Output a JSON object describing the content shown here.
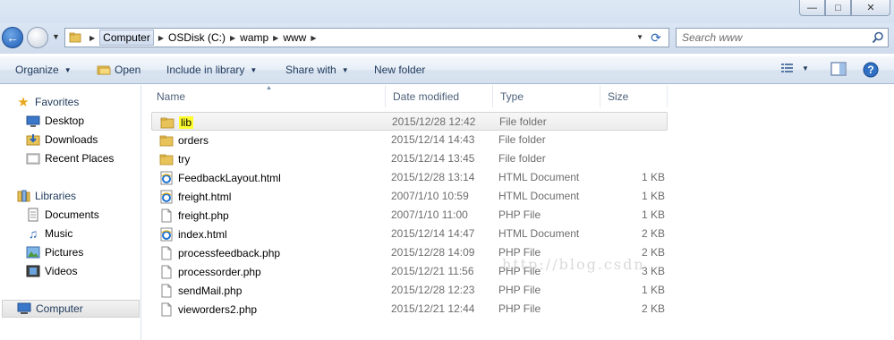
{
  "address": {
    "crumbs": [
      "Computer",
      "OSDisk (C:)",
      "wamp",
      "www"
    ]
  },
  "search": {
    "placeholder": "Search www"
  },
  "toolbar": {
    "organize": "Organize",
    "open": "Open",
    "include_in_library": "Include in library",
    "share_with": "Share with",
    "new_folder": "New folder"
  },
  "nav": {
    "favorites": "Favorites",
    "desktop": "Desktop",
    "downloads": "Downloads",
    "recent_places": "Recent Places",
    "libraries": "Libraries",
    "documents": "Documents",
    "music": "Music",
    "pictures": "Pictures",
    "videos": "Videos",
    "computer": "Computer"
  },
  "columns": {
    "name": "Name",
    "date_modified": "Date modified",
    "type": "Type",
    "size": "Size"
  },
  "files": [
    {
      "name": "lib",
      "date": "2015/12/28 12:42",
      "type": "File folder",
      "size": "",
      "icon": "folder-icon"
    },
    {
      "name": "orders",
      "date": "2015/12/14 14:43",
      "type": "File folder",
      "size": "",
      "icon": "folder-icon"
    },
    {
      "name": "try",
      "date": "2015/12/14 13:45",
      "type": "File folder",
      "size": "",
      "icon": "folder-icon"
    },
    {
      "name": "FeedbackLayout.html",
      "date": "2015/12/28 13:14",
      "type": "HTML Document",
      "size": "1 KB",
      "icon": "ie-html-icon"
    },
    {
      "name": "freight.html",
      "date": "2007/1/10 10:59",
      "type": "HTML Document",
      "size": "1 KB",
      "icon": "ie-html-icon"
    },
    {
      "name": "freight.php",
      "date": "2007/1/10 11:00",
      "type": "PHP File",
      "size": "1 KB",
      "icon": "blank-file-icon"
    },
    {
      "name": "index.html",
      "date": "2015/12/14 14:47",
      "type": "HTML Document",
      "size": "2 KB",
      "icon": "ie-html-icon"
    },
    {
      "name": "processfeedback.php",
      "date": "2015/12/28 14:09",
      "type": "PHP File",
      "size": "2 KB",
      "icon": "blank-file-icon"
    },
    {
      "name": "processorder.php",
      "date": "2015/12/21 11:56",
      "type": "PHP File",
      "size": "3 KB",
      "icon": "blank-file-icon"
    },
    {
      "name": "sendMail.php",
      "date": "2015/12/28 12:23",
      "type": "PHP File",
      "size": "1 KB",
      "icon": "blank-file-icon"
    },
    {
      "name": "vieworders2.php",
      "date": "2015/12/21 12:44",
      "type": "PHP File",
      "size": "2 KB",
      "icon": "blank-file-icon"
    }
  ],
  "watermark": "http://blog.csdn",
  "colors": {
    "highlight": "#ffff2e",
    "selected_row": "#ececec",
    "toolbar_text": "#1e395b"
  }
}
